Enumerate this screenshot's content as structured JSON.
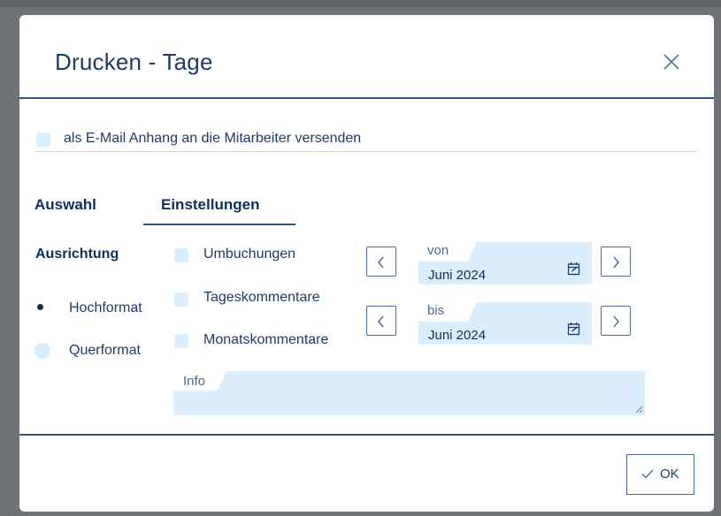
{
  "dialog": {
    "title": "Drucken - Tage",
    "close_icon": "close-icon"
  },
  "email": {
    "label": "als E-Mail Anhang an die Mitarbeiter versenden",
    "checked": false
  },
  "tabs": [
    {
      "label": "Auswahl",
      "active": false
    },
    {
      "label": "Einstellungen",
      "active": true
    }
  ],
  "orientation": {
    "heading": "Ausrichtung",
    "options": [
      {
        "label": "Hochformat",
        "selected": true
      },
      {
        "label": "Querformat",
        "selected": false
      }
    ]
  },
  "options": [
    {
      "label": "Umbuchungen",
      "checked": false
    },
    {
      "label": "Tageskommentare",
      "checked": false
    },
    {
      "label": "Monatskommentare",
      "checked": false
    }
  ],
  "range": {
    "from": {
      "caption": "von",
      "value": "Juni 2024"
    },
    "to": {
      "caption": "bis",
      "value": "Juni 2024"
    },
    "prev_icon": "chevron-left-icon",
    "next_icon": "chevron-right-icon",
    "calendar_icon": "calendar-edit-icon"
  },
  "info": {
    "caption": "Info",
    "value": ""
  },
  "footer": {
    "ok_label": "OK",
    "ok_icon": "check-icon"
  },
  "colors": {
    "accent": "#2f5480",
    "text": "#0e2f55",
    "field_bg": "#dbeefd",
    "overlay": "#6f7378"
  }
}
